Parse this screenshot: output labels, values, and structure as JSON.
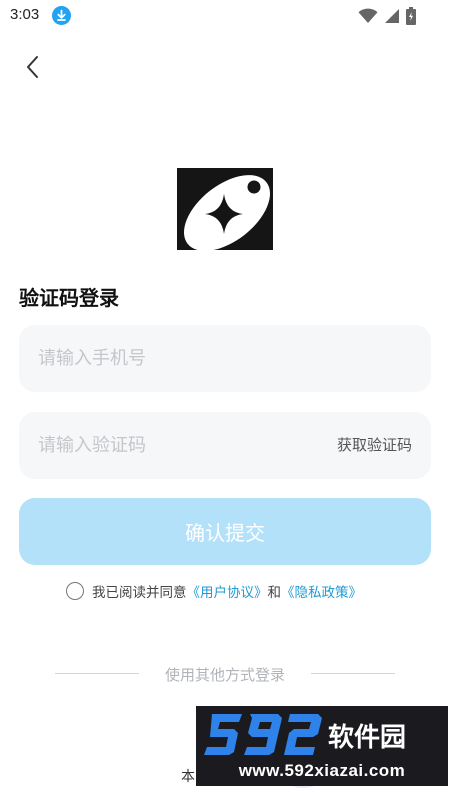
{
  "status_bar": {
    "time": "3:03",
    "icons": [
      "download-icon",
      "wifi-icon",
      "signal-icon",
      "battery-icon"
    ]
  },
  "header": {
    "back_icon": "chevron-left-icon"
  },
  "logo": {
    "icon": "app-logo"
  },
  "login": {
    "title": "验证码登录",
    "phone_placeholder": "请输入手机号",
    "phone_value": "",
    "code_placeholder": "请输入验证码",
    "code_value": "",
    "get_code_label": "获取验证码",
    "submit_label": "确认提交"
  },
  "agreement": {
    "prefix": "我已阅读并同意",
    "user_agreement": "《用户协议》",
    "conjunction": "和",
    "privacy_policy": "《隐私政策》",
    "checked": false
  },
  "other_login": {
    "label": "使用其他方式登录",
    "footer_text": "本"
  },
  "watermark": {
    "brand": "592软件园",
    "url": "www.592xiazai.com"
  },
  "colors": {
    "accent": "#1f9bd6",
    "submit_bg": "#b3e1f9",
    "field_bg": "#f6f7f9",
    "download_badge": "#1fa3f2"
  }
}
